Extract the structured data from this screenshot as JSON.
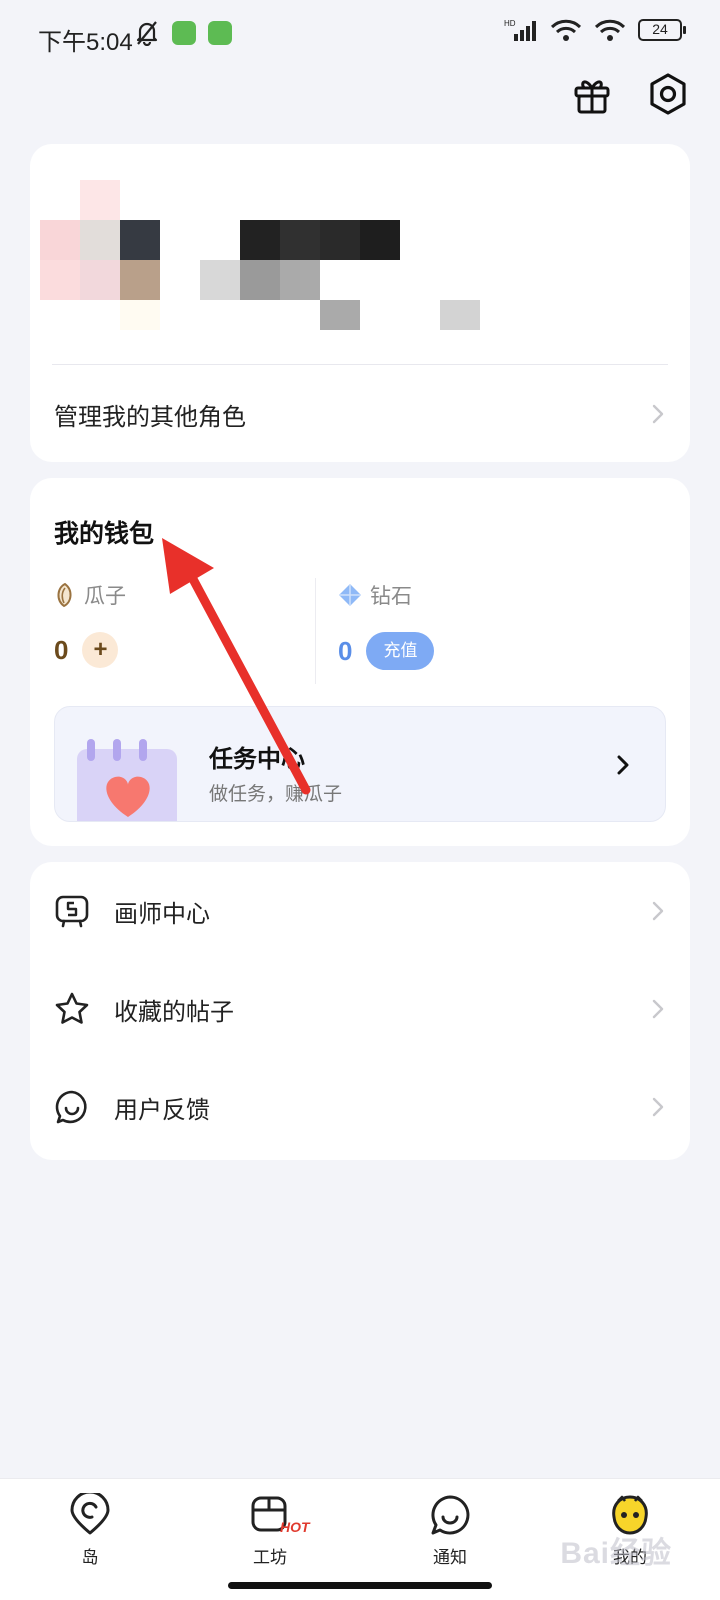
{
  "status_bar": {
    "time": "下午5:04",
    "battery": "24",
    "network": "HD"
  },
  "top_actions": {
    "gift_icon": "gift-icon",
    "settings_icon": "hexagon-gear-icon"
  },
  "profile": {
    "manage_label": "管理我的其他角色"
  },
  "wallet": {
    "title": "我的钱包",
    "seed": {
      "label": "瓜子",
      "value": "0",
      "action": "+"
    },
    "diamond": {
      "label": "钻石",
      "value": "0",
      "action": "充值"
    },
    "task": {
      "title": "任务中心",
      "subtitle": "做任务，赚瓜子"
    }
  },
  "menu": [
    {
      "label": "画师中心",
      "icon": "painter-board-icon"
    },
    {
      "label": "收藏的帖子",
      "icon": "star-icon"
    },
    {
      "label": "用户反馈",
      "icon": "smile-bubble-icon"
    }
  ],
  "bottom_nav": {
    "items": [
      {
        "label": "岛",
        "icon": "island-pin-icon"
      },
      {
        "label": "工坊",
        "icon": "workshop-icon",
        "badge": "HOT"
      },
      {
        "label": "通知",
        "icon": "chat-bubble-icon"
      },
      {
        "label": "我的",
        "icon": "yellow-face-icon",
        "active": true
      }
    ]
  },
  "watermark": "Bai经验",
  "colors": {
    "background": "#f3f4f9",
    "seed_value": "#6b4a1c",
    "diamond_value": "#5a8ee8",
    "recharge_button": "#7eaaf4",
    "annotation_arrow": "#e8302a",
    "hot_badge": "#e03a2e",
    "active_nav_face": "#f7d52a"
  }
}
